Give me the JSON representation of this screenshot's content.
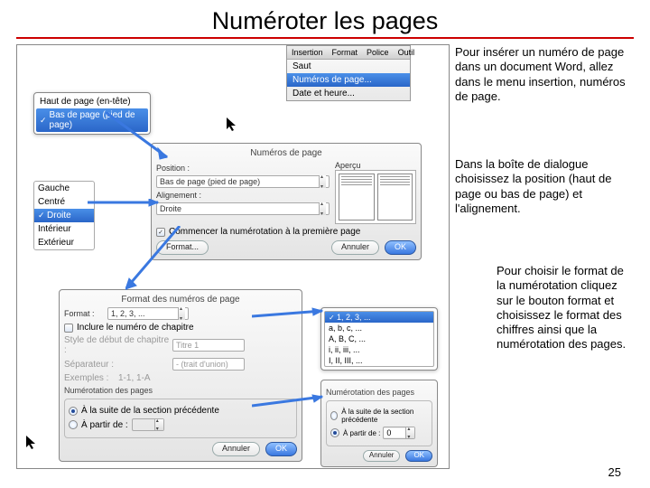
{
  "title": "Numéroter les pages",
  "page_number": "25",
  "paragraphs": {
    "p1": "Pour insérer un numéro de page dans un document Word, allez dans le menu insertion, numéros de page.",
    "p2": "Dans la boîte de dialogue choisissez la position (haut de page ou bas de page) et l'alignement.",
    "p3": "Pour choisir le format de la numérotation cliquez sur le bouton format et choisissez le format des chiffres ainsi que la numérotation des pages."
  },
  "menu": {
    "tabs": [
      "Insertion",
      "Format",
      "Police",
      "Outil"
    ],
    "items": [
      "Saut",
      "Numéros de page...",
      "Date et heure..."
    ],
    "selected": "Numéros de page..."
  },
  "hf_popup": {
    "header": "Haut de page (en-tête)",
    "footer": "Bas de page (pied de page)"
  },
  "align_list": [
    "Gauche",
    "Centré",
    "Droite",
    "Intérieur",
    "Extérieur"
  ],
  "align_selected": "Droite",
  "dlg_np": {
    "title": "Numéros de page",
    "position_lbl": "Position :",
    "position_val": "Bas de page (pied de page)",
    "apercu_lbl": "Aperçu",
    "align_lbl": "Alignement :",
    "align_val": "Droite",
    "first_page": "Commencer la numérotation à la première page",
    "format_btn": "Format...",
    "cancel": "Annuler",
    "ok": "OK"
  },
  "dlg_fmt": {
    "title": "Format des numéros de page",
    "format_lbl": "Format :",
    "format_val": "1, 2, 3, ...",
    "include_chapter": "Inclure le numéro de chapitre",
    "style_lbl": "Style de début de chapitre :",
    "style_val": "Titre 1",
    "sep_lbl": "Séparateur :",
    "sep_val": "- (trait d'union)",
    "examples_lbl": "Exemples :",
    "examples_val": "1-1, 1-A",
    "group_title": "Numérotation des pages",
    "opt_continue": "À la suite de la section précédente",
    "opt_start": "À partir de :",
    "cancel": "Annuler",
    "ok": "OK"
  },
  "fmt_list": {
    "options": [
      "1, 2, 3, ...",
      "a, b, c, ...",
      "A, B, C, ...",
      "i, ii, iii, ...",
      "I, II, III, ..."
    ],
    "selected": "1, 2, 3, ..."
  },
  "dlg_start": {
    "group_title": "Numérotation des pages",
    "opt_continue": "À la suite de la section précédente",
    "opt_start": "À partir de :",
    "start_value": "0",
    "cancel": "Annuler",
    "ok": "OK"
  }
}
